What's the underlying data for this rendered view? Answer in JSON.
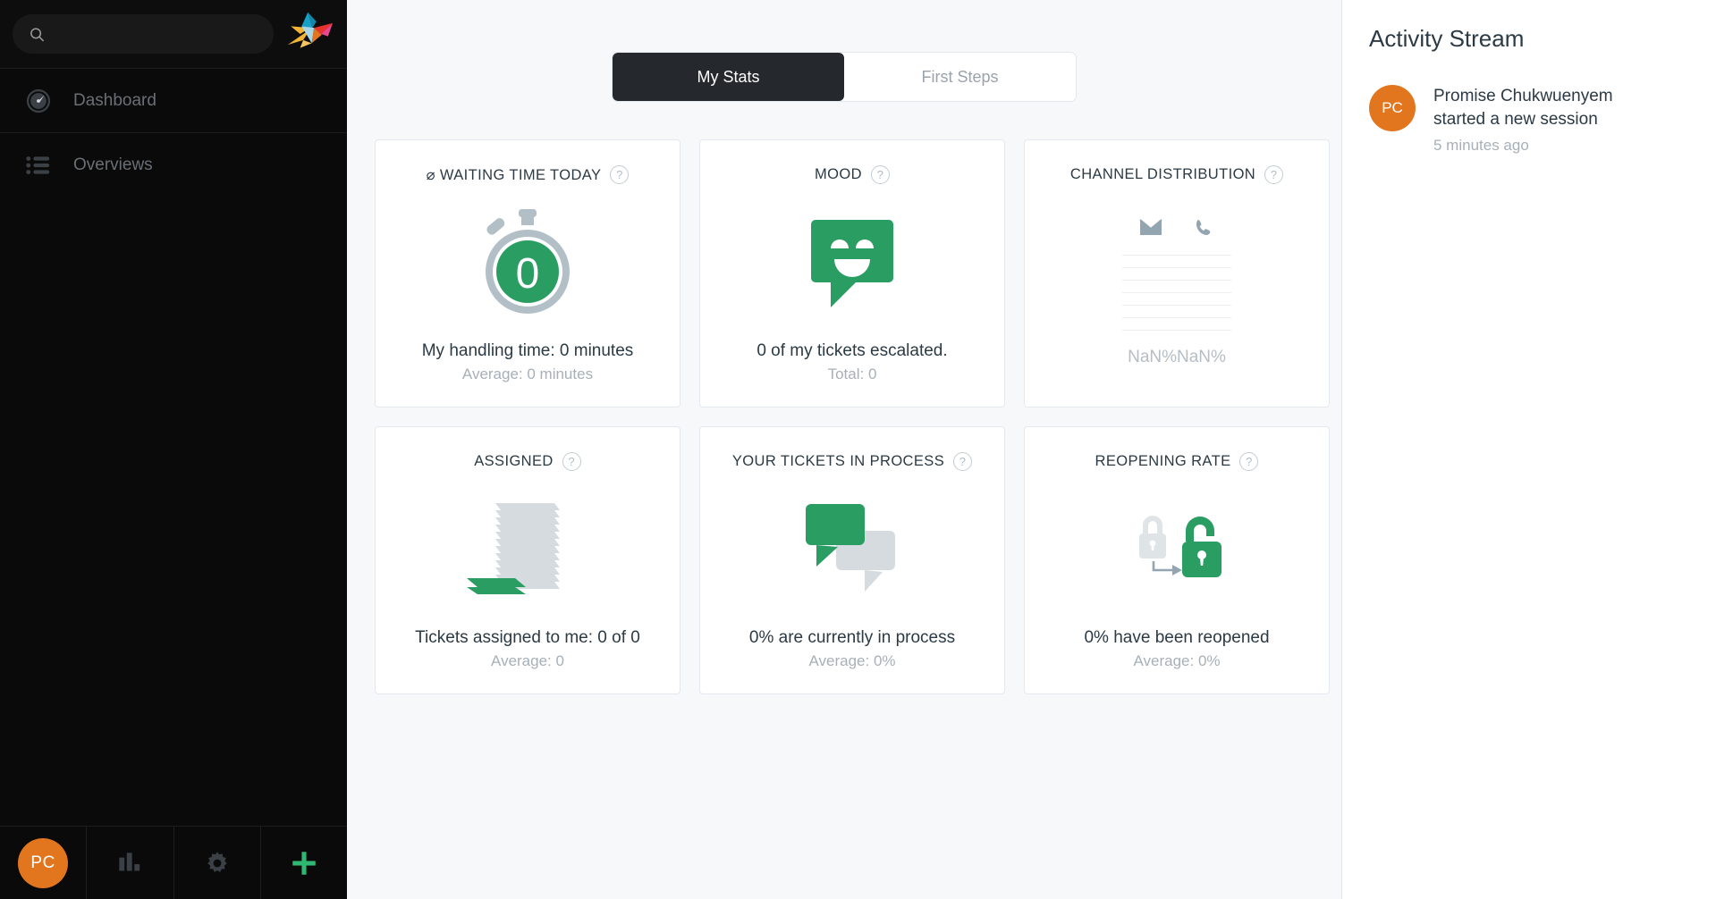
{
  "sidebar": {
    "search": {
      "placeholder": "",
      "value": "",
      "icon": "search-icon"
    },
    "logo": "zammad-origami-bird-logo",
    "nav": [
      {
        "label": "Dashboard",
        "icon": "speedometer-icon"
      },
      {
        "label": "Overviews",
        "icon": "list-icon"
      }
    ],
    "bottom": [
      {
        "name": "user-avatar",
        "label": "PC",
        "icon": "avatar"
      },
      {
        "name": "reports",
        "label": "",
        "icon": "bar-chart-icon"
      },
      {
        "name": "settings",
        "label": "",
        "icon": "gear-icon"
      },
      {
        "name": "new",
        "label": "",
        "icon": "plus-icon"
      }
    ]
  },
  "main": {
    "tabs": [
      {
        "label": "My Stats",
        "active": true
      },
      {
        "label": "First Steps",
        "active": false
      }
    ],
    "cards": [
      {
        "title": "⌀ WAITING TIME TODAY",
        "help": "?",
        "visual": "stopwatch-icon",
        "value": "0",
        "main_text": "My handling time: 0 minutes",
        "sub_text": "Average: 0 minutes"
      },
      {
        "title": "MOOD",
        "help": "?",
        "visual": "smiling-speech-bubble-icon",
        "main_text": "0 of my tickets escalated.",
        "sub_text": "Total: 0"
      },
      {
        "title": "CHANNEL DISTRIBUTION",
        "help": "?",
        "visual": "channel-bar-chart",
        "channels": [
          "email-icon",
          "phone-icon"
        ],
        "values_text": "NaN%NaN%",
        "gridlines": 7
      },
      {
        "title": "ASSIGNED",
        "help": "?",
        "visual": "paper-stack-icon",
        "main_text": "Tickets assigned to me: 0 of 0",
        "sub_text": "Average: 0"
      },
      {
        "title": "YOUR TICKETS IN PROCESS",
        "help": "?",
        "visual": "two-speech-bubbles-icon",
        "main_text": "0% are currently in process",
        "sub_text": "Average: 0%"
      },
      {
        "title": "REOPENING RATE",
        "help": "?",
        "visual": "lock-to-open-lock-icon",
        "main_text": "0% have been reopened",
        "sub_text": "Average: 0%"
      }
    ]
  },
  "activity": {
    "title": "Activity Stream",
    "items": [
      {
        "avatar_initials": "PC",
        "text": "Promise Chukwuenyem started a new session",
        "time": "5 minutes ago"
      }
    ]
  },
  "colors": {
    "accent_green": "#2a9d63",
    "avatar_orange": "#e2761f",
    "sidebar_bg": "#0a0a0a",
    "page_bg": "#f7f8fa",
    "card_border": "#e4e9ef",
    "muted_gray": "#c4cdd3"
  },
  "chart_data": {
    "type": "bar",
    "title": "Channel Distribution",
    "categories": [
      "Email",
      "Phone"
    ],
    "values": [
      null,
      null
    ],
    "value_labels": [
      "NaN%",
      "NaN%"
    ],
    "gridlines": 7,
    "grid": true,
    "legend": "none",
    "xlabel": "",
    "ylabel": ""
  }
}
